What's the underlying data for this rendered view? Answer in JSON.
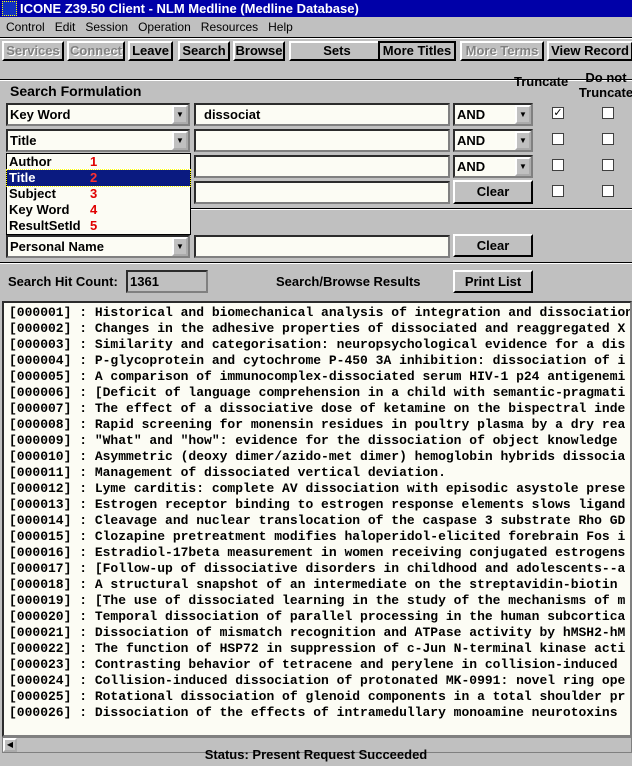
{
  "window": {
    "title": "ICONE Z39.50 Client - NLM Medline (Medline Database)"
  },
  "menu": [
    "Control",
    "Edit",
    "Session",
    "Operation",
    "Resources",
    "Help"
  ],
  "toolbar": [
    {
      "label": "Services",
      "enabled": false
    },
    {
      "label": "Connect",
      "enabled": false
    },
    {
      "label": "Leave",
      "enabled": true
    },
    {
      "label": "Search",
      "enabled": true
    },
    {
      "label": "Browse",
      "enabled": true
    },
    {
      "label": "Sets",
      "enabled": true
    },
    {
      "label": "More Titles",
      "enabled": true,
      "pressed": true
    },
    {
      "label": "More Terms",
      "enabled": false
    },
    {
      "label": "View Record",
      "enabled": true
    }
  ],
  "search": {
    "heading": "Search Formulation",
    "truncate_label": "Truncate",
    "no_truncate_label": "Do not Truncate",
    "rows": [
      {
        "field": "Key Word",
        "term": "dissociat",
        "operator": "AND",
        "truncate": true,
        "no_truncate": false
      },
      {
        "field": "Title",
        "term": "",
        "operator": "AND",
        "truncate": false,
        "no_truncate": false
      },
      {
        "field": "",
        "term": "",
        "operator": "AND",
        "truncate": false,
        "no_truncate": false
      },
      {
        "field": "",
        "term": "",
        "truncate": false,
        "no_truncate": false
      }
    ],
    "clear_label": "Clear",
    "dropdown": [
      {
        "label": "Author",
        "num": "1"
      },
      {
        "label": "Title",
        "num": "2",
        "selected": true
      },
      {
        "label": "Subject",
        "num": "3"
      },
      {
        "label": "Key Word",
        "num": "4"
      },
      {
        "label": "ResultSetId",
        "num": "5"
      }
    ],
    "browse": {
      "field": "Personal Name",
      "term": "",
      "clear_label": "Clear"
    }
  },
  "hits": {
    "label": "Search Hit Count:",
    "value": "1361",
    "results_label": "Search/Browse Results",
    "print_label": "Print List"
  },
  "results": [
    "[000001] : Historical and biomechanical analysis of integration and dissociation",
    "[000002] : Changes in the adhesive properties of dissociated and reaggregated X",
    "[000003] : Similarity and categorisation: neuropsychological evidence for a dis",
    "[000004] : P-glycoprotein and cytochrome P-450 3A inhibition: dissociation of i",
    "[000005] : A comparison of immunocomplex-dissociated serum HIV-1 p24 antigenemi",
    "[000006] : [Deficit of language comprehension in a child with semantic-pragmati",
    "[000007] : The effect of a dissociative dose of ketamine on the bispectral inde",
    "[000008] : Rapid screening for monensin residues in poultry plasma by a dry rea",
    "[000009] : \"What\" and \"how\": evidence for the dissociation of object knowledge",
    "[000010] : Asymmetric (deoxy dimer/azido-met dimer) hemoglobin hybrids dissocia",
    "[000011] : Management of dissociated vertical deviation.",
    "[000012] : Lyme carditis: complete AV dissociation with episodic asystole prese",
    "[000013] : Estrogen receptor binding to estrogen response elements slows ligand",
    "[000014] : Cleavage and nuclear translocation of the caspase 3 substrate Rho GD",
    "[000015] : Clozapine pretreatment modifies haloperidol-elicited forebrain Fos i",
    "[000016] : Estradiol-17beta measurement in women receiving conjugated estrogens",
    "[000017] : [Follow-up of dissociative disorders in childhood and adolescents--a",
    "[000018] : A structural snapshot of an intermediate on the streptavidin-biotin",
    "[000019] : [The use of dissociated learning in the study of the mechanisms of m",
    "[000020] : Temporal dissociation of parallel processing in the human subcortica",
    "[000021] : Dissociation of mismatch recognition and ATPase activity by hMSH2-hM",
    "[000022] : The function of HSP72 in suppression of c-Jun N-terminal kinase acti",
    "[000023] : Contrasting behavior of tetracene and perylene in collision-induced",
    "[000024] : Collision-induced dissociation of protonated MK-0991: novel ring ope",
    "[000025] : Rotational dissociation of glenoid components in a total shoulder pr",
    "[000026] : Dissociation of the effects of intramedullary monoamine neurotoxins"
  ],
  "status": "Status:  Present Request Succeeded"
}
